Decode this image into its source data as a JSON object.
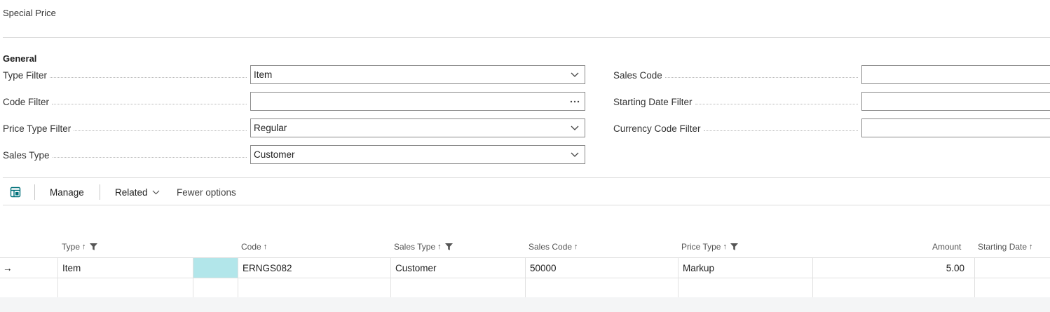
{
  "page": {
    "title": "Special Price"
  },
  "general": {
    "title": "General",
    "left_fields": [
      {
        "label": "Type Filter",
        "value": "Item",
        "control": "dropdown"
      },
      {
        "label": "Code Filter",
        "value": "",
        "control": "lookup"
      },
      {
        "label": "Price Type Filter",
        "value": "Regular",
        "control": "dropdown"
      },
      {
        "label": "Sales Type",
        "value": "Customer",
        "control": "dropdown"
      }
    ],
    "right_fields": [
      {
        "label": "Sales Code",
        "value": ""
      },
      {
        "label": "Starting Date Filter",
        "value": ""
      },
      {
        "label": "Currency Code Filter",
        "value": ""
      }
    ]
  },
  "toolbar": {
    "icon": "grid-view-icon",
    "manage": "Manage",
    "related": "Related",
    "fewer": "Fewer options"
  },
  "grid": {
    "columns": [
      {
        "label": "Type",
        "sort": "↑",
        "filtered": true
      },
      {
        "label": "Code",
        "sort": "↑",
        "filtered": false
      },
      {
        "label": "Sales Type",
        "sort": "↑",
        "filtered": true
      },
      {
        "label": "Sales Code",
        "sort": "↑",
        "filtered": false
      },
      {
        "label": "Price Type",
        "sort": "↑",
        "filtered": true
      },
      {
        "label": "Amount",
        "sort": "",
        "filtered": false
      },
      {
        "label": "Starting Date",
        "sort": "↑",
        "filtered": false
      }
    ],
    "rows": [
      {
        "indicator": "→",
        "type": "Item",
        "code": "ERNGS082",
        "sales_type": "Customer",
        "sales_code": "50000",
        "price_type": "Markup",
        "amount": "5.00",
        "starting_date": ""
      }
    ]
  },
  "colors": {
    "selected_cell": "#b2e6ea",
    "accent": "#00717a"
  }
}
